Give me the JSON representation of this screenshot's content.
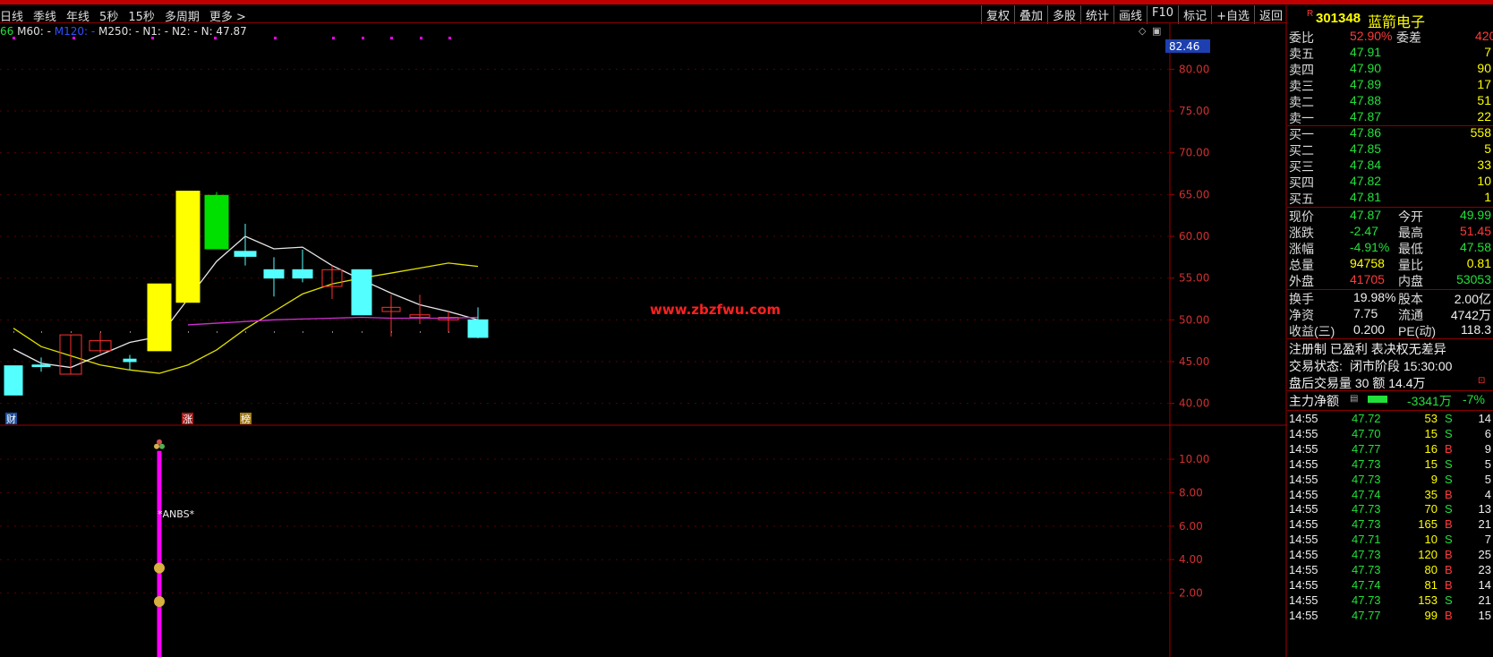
{
  "toolbar": {
    "left": [
      "日线",
      "季线",
      "年线",
      "5秒",
      "15秒",
      "多周期",
      "更多 >"
    ],
    "right": [
      "复权",
      "叠加",
      "多股",
      "统计",
      "画线",
      "F10",
      "标记",
      "+自选",
      "返回"
    ]
  },
  "indicator": {
    "parts": [
      {
        "text": "66",
        "color": "#22e03a"
      },
      {
        "text": " M60: -",
        "color": "#e0e0e0"
      },
      {
        "text": " M120: -",
        "color": "#3050ff"
      },
      {
        "text": " M250: -",
        "color": "#e0e0e0"
      },
      {
        "text": " N1: -",
        "color": "#e0e0e0"
      },
      {
        "text": " N2: -",
        "color": "#e0e0e0"
      },
      {
        "text": " N: 47.87",
        "color": "#e0e0e0"
      }
    ]
  },
  "price_axis": {
    "current_tag": "82.46",
    "ticks": [
      "80.00",
      "75.00",
      "70.00",
      "65.00",
      "60.00",
      "55.00",
      "50.00",
      "45.00",
      "40.00"
    ],
    "values": [
      80,
      75,
      70,
      65,
      60,
      55,
      50,
      45,
      40
    ]
  },
  "sub_axis": {
    "ticks": [
      "10.00",
      "8.00",
      "6.00",
      "4.00",
      "2.00"
    ],
    "values": [
      10,
      8,
      6,
      4,
      2
    ]
  },
  "markers": {
    "cai": "财",
    "zhang": "涨",
    "bang": "榜"
  },
  "watermark": "www.zbzfwu.com",
  "anbs_label": "*ANBS*",
  "chart_data": {
    "type": "candlestick",
    "candles": [
      {
        "open": 44.5,
        "close": 41.0,
        "high": 44.5,
        "low": 41.0
      },
      {
        "open": 44.6,
        "close": 44.4,
        "high": 45.5,
        "low": 43.8
      },
      {
        "open": 43.5,
        "close": 48.2,
        "high": 48.2,
        "low": 43.5
      },
      {
        "open": 46.3,
        "close": 47.5,
        "high": 48.5,
        "low": 46.0
      },
      {
        "open": 45.3,
        "close": 45.0,
        "high": 45.8,
        "low": 44.0
      },
      {
        "open": 46.3,
        "close": 54.3,
        "high": 54.3,
        "low": 46.3
      },
      {
        "open": 52.1,
        "close": 65.4,
        "high": 65.4,
        "low": 52.1
      },
      {
        "open": 64.9,
        "close": 58.5,
        "high": 65.3,
        "low": 58.5
      },
      {
        "open": 58.2,
        "close": 57.6,
        "high": 61.5,
        "low": 56.5
      },
      {
        "open": 56.0,
        "close": 55.0,
        "high": 57.5,
        "low": 52.8
      },
      {
        "open": 56.0,
        "close": 55.0,
        "high": 58.4,
        "low": 54.5
      },
      {
        "open": 54.0,
        "close": 56.0,
        "high": 56.5,
        "low": 52.5
      },
      {
        "open": 56.0,
        "close": 50.6,
        "high": 56.0,
        "low": 50.6
      },
      {
        "open": 51.0,
        "close": 51.5,
        "high": 53.0,
        "low": 48.0
      },
      {
        "open": 50.3,
        "close": 50.6,
        "high": 53.0,
        "low": 49.5
      },
      {
        "open": 50.0,
        "close": 50.3,
        "high": 51.0,
        "low": 48.5
      },
      {
        "open": 50.0,
        "close": 47.9,
        "high": 51.5,
        "low": 47.8
      }
    ],
    "ma_white": [
      46.5,
      44.8,
      44.3,
      45.8,
      47.3,
      48.0,
      52.5,
      57.0,
      60.0,
      58.5,
      58.7,
      56.5,
      54.8,
      53.2,
      51.8,
      51.0,
      50.0
    ],
    "ma_yellow": [
      46.8,
      45.7,
      44.6,
      44.0,
      43.6,
      44.6,
      46.4,
      48.9,
      51.0,
      53.1,
      54.3,
      55.0,
      55.6,
      56.2,
      56.8,
      56.4,
      54.0
    ],
    "ma_magenta": [
      null,
      null,
      null,
      null,
      null,
      null,
      49.4,
      49.6,
      49.8,
      50.0,
      50.1,
      50.2,
      50.3,
      50.2,
      50.2,
      50.2,
      50.3
    ],
    "ylim": [
      39,
      84
    ],
    "sub_ylim": [
      0,
      11.5
    ],
    "sub_bar": {
      "index": 5,
      "top": 10.5
    }
  },
  "stock": {
    "badge": "R",
    "code": "301348",
    "name": "蓝箭电子"
  },
  "weibi": {
    "label": "委比",
    "value": "52.90%",
    "label2": "委差",
    "value2": "420"
  },
  "sell": [
    {
      "label": "卖五",
      "price": "47.91",
      "vol": "7"
    },
    {
      "label": "卖四",
      "price": "47.90",
      "vol": "90"
    },
    {
      "label": "卖三",
      "price": "47.89",
      "vol": "17"
    },
    {
      "label": "卖二",
      "price": "47.88",
      "vol": "51"
    },
    {
      "label": "卖一",
      "price": "47.87",
      "vol": "22"
    }
  ],
  "buy": [
    {
      "label": "买一",
      "price": "47.86",
      "vol": "558"
    },
    {
      "label": "买二",
      "price": "47.85",
      "vol": "5"
    },
    {
      "label": "买三",
      "price": "47.84",
      "vol": "33"
    },
    {
      "label": "买四",
      "price": "47.82",
      "vol": "10"
    },
    {
      "label": "买五",
      "price": "47.81",
      "vol": "1"
    }
  ],
  "quote": [
    {
      "l1": "现价",
      "v1": "47.87",
      "c1": "green",
      "l2": "今开",
      "v2": "49.99",
      "c2": "green"
    },
    {
      "l1": "涨跌",
      "v1": "-2.47",
      "c1": "green",
      "l2": "最高",
      "v2": "51.45",
      "c2": "red"
    },
    {
      "l1": "涨幅",
      "v1": "-4.91%",
      "c1": "green",
      "l2": "最低",
      "v2": "47.58",
      "c2": "green"
    },
    {
      "l1": "总量",
      "v1": "94758",
      "c1": "yellow",
      "l2": "量比",
      "v2": "0.81",
      "c2": "yellow"
    },
    {
      "l1": "外盘",
      "v1": "41705",
      "c1": "red",
      "l2": "内盘",
      "v2": "53053",
      "c2": "green"
    }
  ],
  "quote2": [
    {
      "l1": "换手",
      "v1": "19.98%",
      "l2": "股本",
      "v2": "2.00亿"
    },
    {
      "l1": "净资",
      "v1": "7.75",
      "l2": "流通",
      "v2": "4742万"
    },
    {
      "l1": "收益(三)",
      "v1": "0.200",
      "l2": "PE(动)",
      "v2": "118.3"
    }
  ],
  "info": {
    "line1": "注册制 已盈利 表决权无差异",
    "line2_label": "交易状态:",
    "line2_value": "闭市阶段 15:30:00",
    "line3": "盘后交易量 30 额 14.4万",
    "flow_label": "主力净额",
    "flow_value": "-3341万",
    "flow_pct": "-7%"
  },
  "ticks": [
    {
      "time": "14:55",
      "price": "47.72",
      "vol": "53",
      "side": "S",
      "n": "14"
    },
    {
      "time": "14:55",
      "price": "47.70",
      "vol": "15",
      "side": "S",
      "n": "6"
    },
    {
      "time": "14:55",
      "price": "47.77",
      "vol": "16",
      "side": "B",
      "n": "9"
    },
    {
      "time": "14:55",
      "price": "47.73",
      "vol": "15",
      "side": "S",
      "n": "5"
    },
    {
      "time": "14:55",
      "price": "47.73",
      "vol": "9",
      "side": "S",
      "n": "5"
    },
    {
      "time": "14:55",
      "price": "47.74",
      "vol": "35",
      "side": "B",
      "n": "4"
    },
    {
      "time": "14:55",
      "price": "47.73",
      "vol": "70",
      "side": "S",
      "n": "13"
    },
    {
      "time": "14:55",
      "price": "47.73",
      "vol": "165",
      "side": "B",
      "n": "21"
    },
    {
      "time": "14:55",
      "price": "47.71",
      "vol": "10",
      "side": "S",
      "n": "7"
    },
    {
      "time": "14:55",
      "price": "47.73",
      "vol": "120",
      "side": "B",
      "n": "25"
    },
    {
      "time": "14:55",
      "price": "47.73",
      "vol": "80",
      "side": "B",
      "n": "23"
    },
    {
      "time": "14:55",
      "price": "47.74",
      "vol": "81",
      "side": "B",
      "n": "14"
    },
    {
      "time": "14:55",
      "price": "47.73",
      "vol": "153",
      "side": "S",
      "n": "21"
    },
    {
      "time": "14:55",
      "price": "47.77",
      "vol": "99",
      "side": "B",
      "n": "15"
    }
  ],
  "colors": {
    "up": "#ff3030",
    "down_green": "#00e000",
    "down_cyan": "#54ffff",
    "boom_yellow": "#ffff00",
    "grid_red": "#8b0000",
    "magenta": "#ff00ff",
    "current_tag_bg": "#1d3fb0"
  }
}
